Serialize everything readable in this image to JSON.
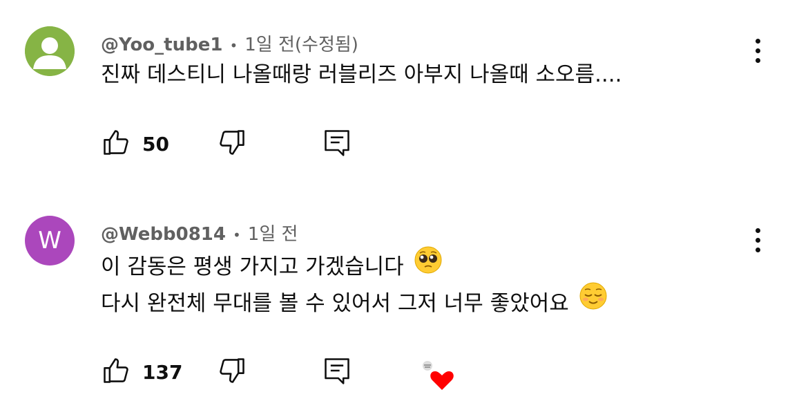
{
  "comments": [
    {
      "avatar_letter": "",
      "avatar_color": "#86b445",
      "author": "@Yoo_tube1",
      "separator": "•",
      "time": "1일 전(수정됨)",
      "text_lines": [
        "진짜 데스티니 나올때랑 러블리즈 아부지 나올때 소오름...."
      ],
      "likes": "50",
      "icons": [
        "thumbs-up-icon",
        "thumbs-down-icon",
        "reply-icon",
        "more-vert-icon"
      ]
    },
    {
      "avatar_letter": "W",
      "avatar_color": "#ab47bc",
      "author": "@Webb0814",
      "separator": "•",
      "time": "1일 전",
      "text_lines": [
        "이 감동은 평생 가지고 가겠습니다",
        "다시 완전체 무대를 볼 수 있어서 그저 너무 좋았어요"
      ],
      "emojis": [
        "pleading-face",
        "relieved-face"
      ],
      "likes": "137",
      "creator_heart": true,
      "icons": [
        "thumbs-up-icon",
        "thumbs-down-icon",
        "reply-icon",
        "more-vert-icon",
        "creator-heart-icon"
      ]
    }
  ]
}
